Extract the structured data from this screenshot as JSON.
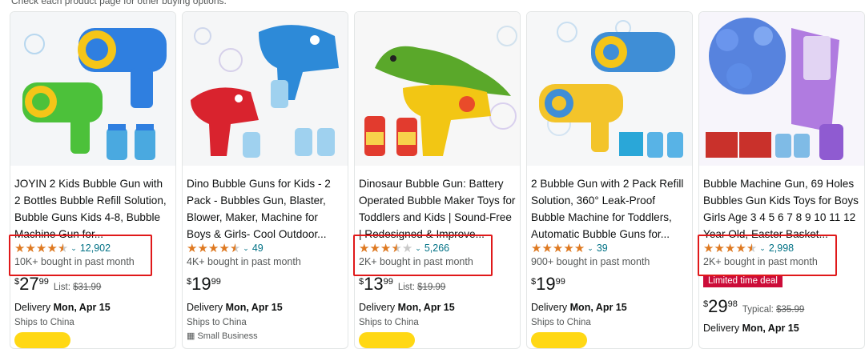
{
  "header_note": "Check each product page for other buying options.",
  "colors": {
    "star": "#de7921",
    "link": "#007185",
    "deal": "#cc0c39",
    "highlight_box": "#e0191a",
    "cart_button": "#ffd814"
  },
  "products": [
    {
      "title": "JOYIN 2 Kids Bubble Gun with 2 Bottles Bubble Refill Solution, Bubble Guns Kids 4-8, Bubble Machine Gun for...",
      "rating": 4.5,
      "review_count": "12,902",
      "bought": "10K+ bought in past month",
      "price_symbol": "$",
      "price_whole": "27",
      "price_fraction": "99",
      "list_label": "List:",
      "list_price": "$31.99",
      "delivery_label": "Delivery",
      "delivery_date": "Mon, Apr 15",
      "ships": "Ships to China"
    },
    {
      "title": "Dino Bubble Guns for Kids - 2 Pack - Bubbles Gun, Blaster, Blower, Maker, Machine for Boys & Girls- Cool Outdoor...",
      "rating": 4.5,
      "review_count": "49",
      "bought": "4K+ bought in past month",
      "price_symbol": "$",
      "price_whole": "19",
      "price_fraction": "99",
      "delivery_label": "Delivery",
      "delivery_date": "Mon, Apr 15",
      "ships": "Ships to China",
      "small_business": "Small Business"
    },
    {
      "title": "Dinosaur Bubble Gun: Battery Operated Bubble Maker Toys for Toddlers and Kids | Sound-Free | Redesigned & Improve...",
      "rating": 3.5,
      "review_count": "5,266",
      "bought": "2K+ bought in past month",
      "price_symbol": "$",
      "price_whole": "13",
      "price_fraction": "99",
      "list_label": "List:",
      "list_price": "$19.99",
      "delivery_label": "Delivery",
      "delivery_date": "Mon, Apr 15",
      "ships": "Ships to China"
    },
    {
      "title": "2 Bubble Gun with 2 Pack Refill Solution, 360° Leak-Proof Bubble Machine for Toddlers, Automatic Bubble Guns for...",
      "rating": 5,
      "review_count": "39",
      "bought": "900+ bought in past month",
      "price_symbol": "$",
      "price_whole": "19",
      "price_fraction": "99",
      "delivery_label": "Delivery",
      "delivery_date": "Mon, Apr 15",
      "ships": "Ships to China"
    },
    {
      "title": "Bubble Machine Gun, 69 Holes Bubbles Gun Kids Toys for Boys Girls Age 3 4 5 6 7 8 9 10 11 12 Year Old, Easter Basket...",
      "rating": 4.5,
      "review_count": "2,998",
      "bought": "2K+ bought in past month",
      "deal_badge": "Limited time deal",
      "price_symbol": "$",
      "price_whole": "29",
      "price_fraction": "98",
      "list_label": "Typical:",
      "list_price": "$35.99",
      "delivery_label": "Delivery",
      "delivery_date": "Mon, Apr 15"
    }
  ]
}
